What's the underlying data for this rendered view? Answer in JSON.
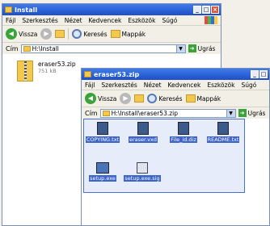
{
  "back_window": {
    "title": "Install",
    "menu": [
      "Fájl",
      "Szerkesztés",
      "Nézet",
      "Kedvencek",
      "Eszközök",
      "Súgó"
    ],
    "toolbar": {
      "back": "Vissza",
      "search": "Keresés",
      "folders": "Mappák"
    },
    "address_label": "Cím",
    "address_value": "H:\\Install",
    "go_label": "Ugrás",
    "file": {
      "name": "eraser53.zip",
      "size": "751 kB"
    }
  },
  "front_window": {
    "title": "eraser53.zip",
    "menu": [
      "Fájl",
      "Szerkesztés",
      "Nézet",
      "Kedvencek",
      "Eszközök",
      "Súgó"
    ],
    "toolbar": {
      "back": "Vissza",
      "search": "Keresés",
      "folders": "Mappák"
    },
    "address_label": "Cím",
    "address_value": "H:\\Install\\eraser53.zip",
    "go_label": "Ugrás",
    "files": [
      "COPYING.txt",
      "eraser.vxd",
      "File_id.diz",
      "README.txt",
      "setup.exe",
      "setup.exe.sig"
    ]
  },
  "colors": {
    "title_bar": "#2b62d9",
    "selection": "#3d64c9"
  }
}
